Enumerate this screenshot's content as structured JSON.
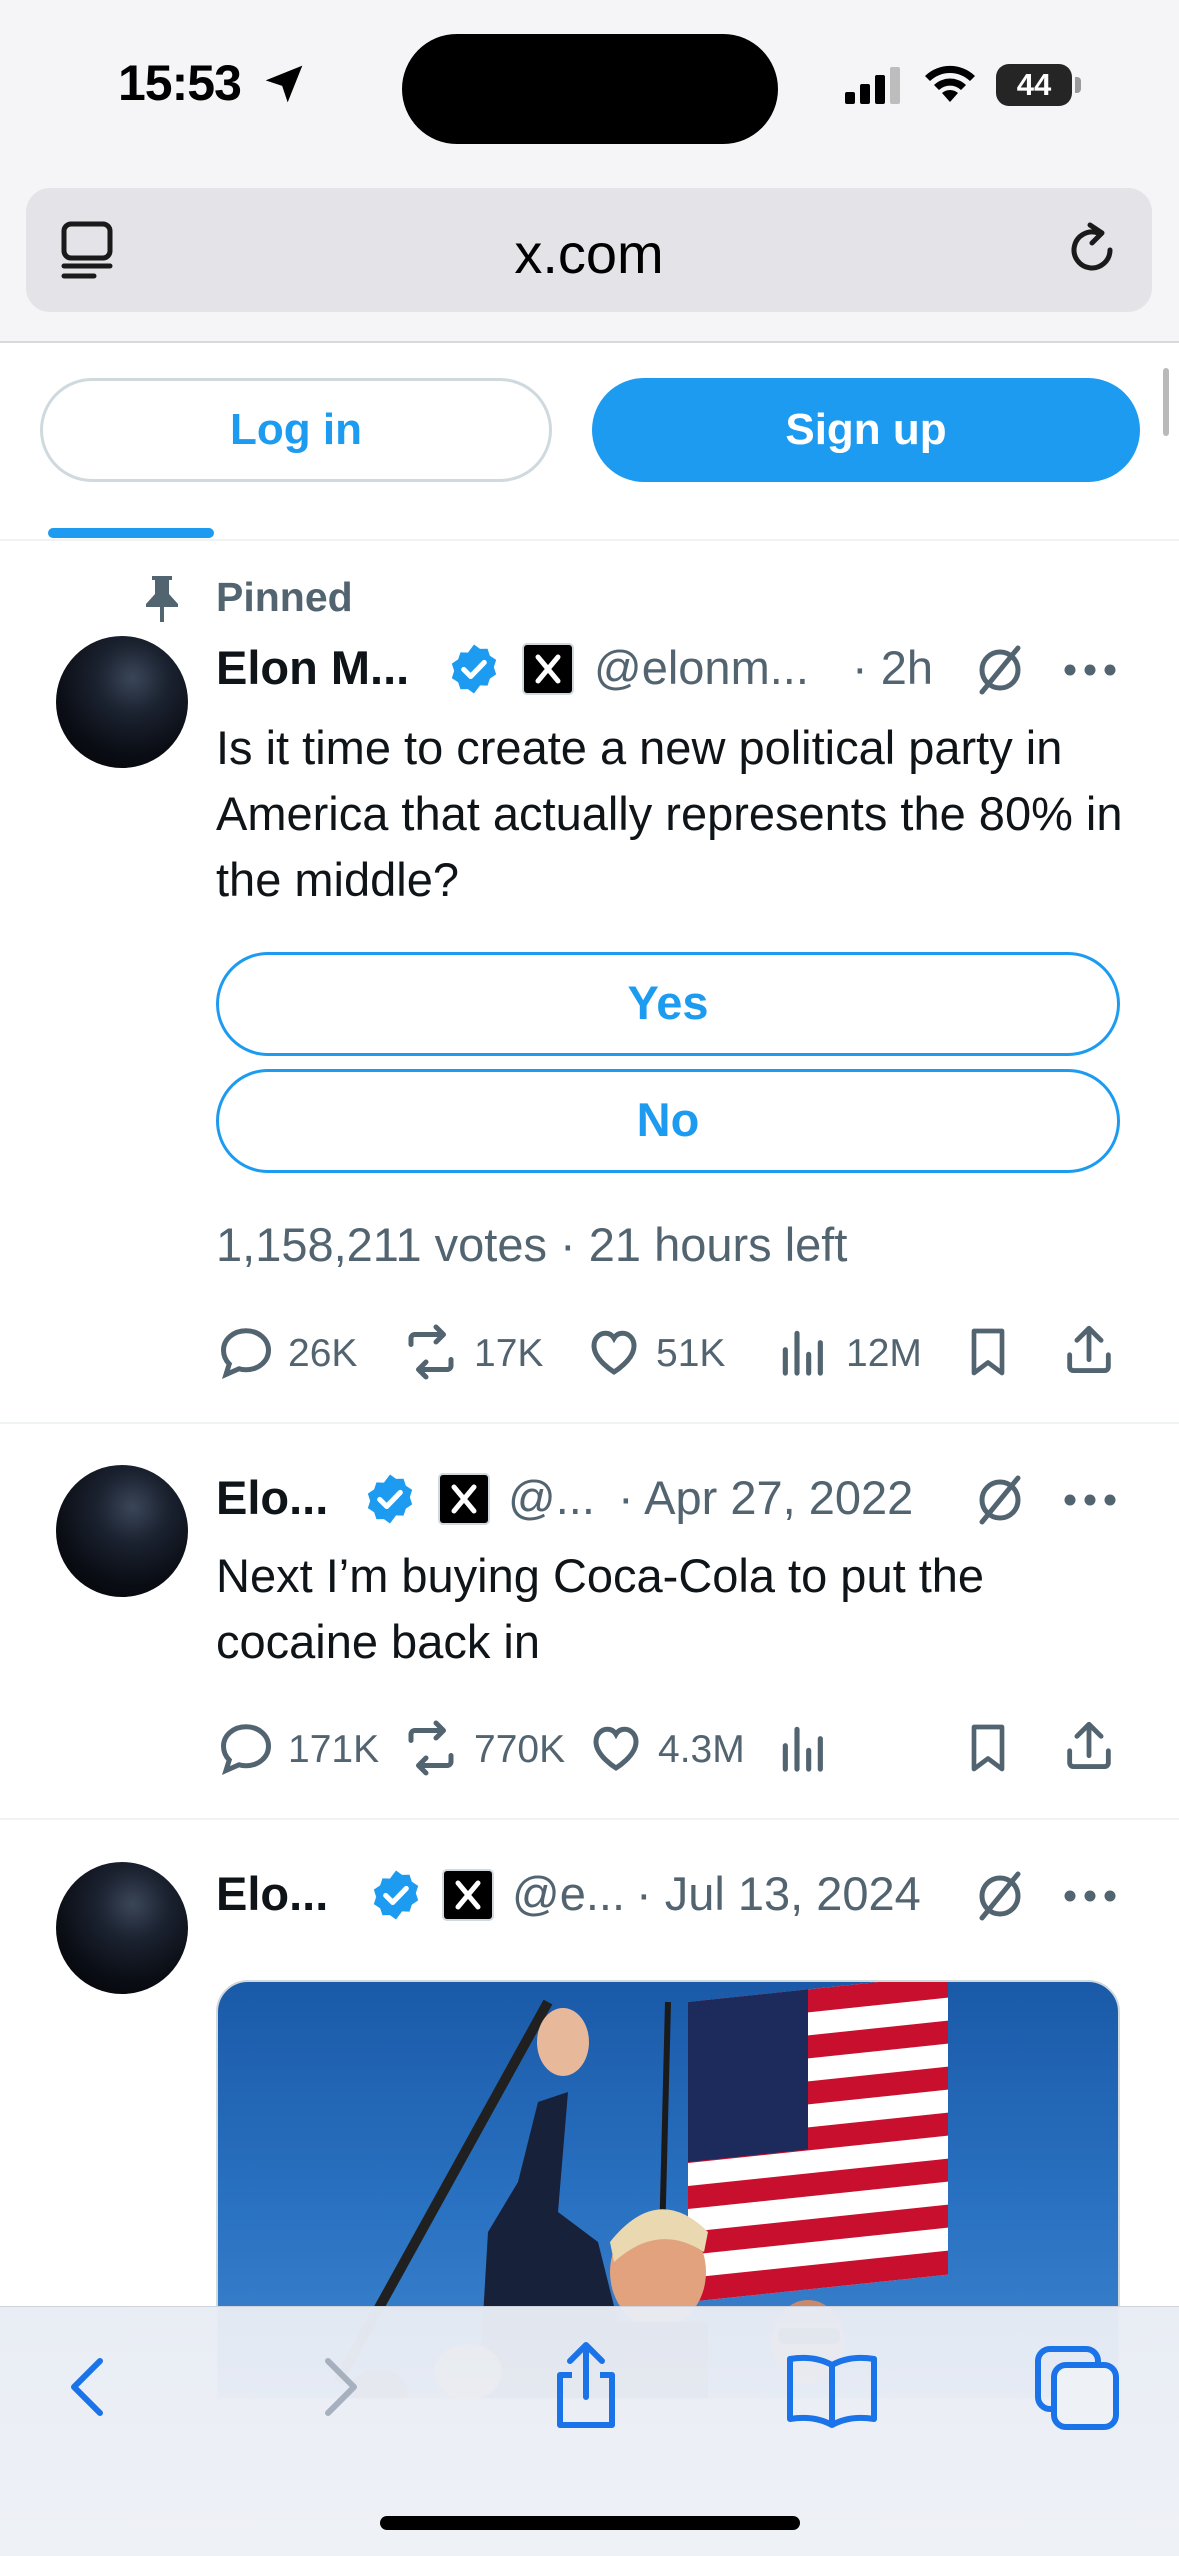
{
  "status_bar": {
    "time": "15:53",
    "battery": "44"
  },
  "browser": {
    "url": "x.com"
  },
  "auth": {
    "login_label": "Log in",
    "signup_label": "Sign up"
  },
  "tweets": [
    {
      "pinned_label": "Pinned",
      "name": "Elon M...",
      "handle": "@elonm...",
      "time": "· 2h",
      "text": "Is it time to create a new political party in America that actually represents the 80% in the middle?",
      "poll": {
        "options": [
          "Yes",
          "No"
        ],
        "summary": "1,158,211 votes · 21 hours left"
      },
      "stats": {
        "replies": "26K",
        "reposts": "17K",
        "likes": "51K",
        "views": "12M"
      }
    },
    {
      "name": "Elo...",
      "handle": "@...",
      "time": "· Apr 27, 2022",
      "text": "Next I’m buying Coca-Cola to put the cocaine back in",
      "stats": {
        "replies": "171K",
        "reposts": "770K",
        "likes": "4.3M"
      }
    },
    {
      "name": "Elo...",
      "handle": "@e...",
      "time": "· Jul 13, 2024"
    }
  ],
  "colors": {
    "accent": "#1d9bf0",
    "secondary_text": "#536471",
    "divider": "#eff3f4"
  },
  "icons": {
    "status": [
      "location-arrow-icon",
      "cellular-signal-icon",
      "wifi-icon",
      "battery-icon"
    ],
    "browser": [
      "reader-mode-icon",
      "reload-icon"
    ],
    "tweet_header": [
      "verified-badge-icon",
      "x-affiliate-badge-icon",
      "grok-icon",
      "more-icon"
    ],
    "tweet_actions": [
      "reply-icon",
      "repost-icon",
      "like-icon",
      "views-icon",
      "bookmark-icon",
      "share-icon"
    ],
    "toolbar": [
      "back-icon",
      "forward-icon",
      "share-icon",
      "bookmarks-icon",
      "tabs-icon"
    ]
  }
}
